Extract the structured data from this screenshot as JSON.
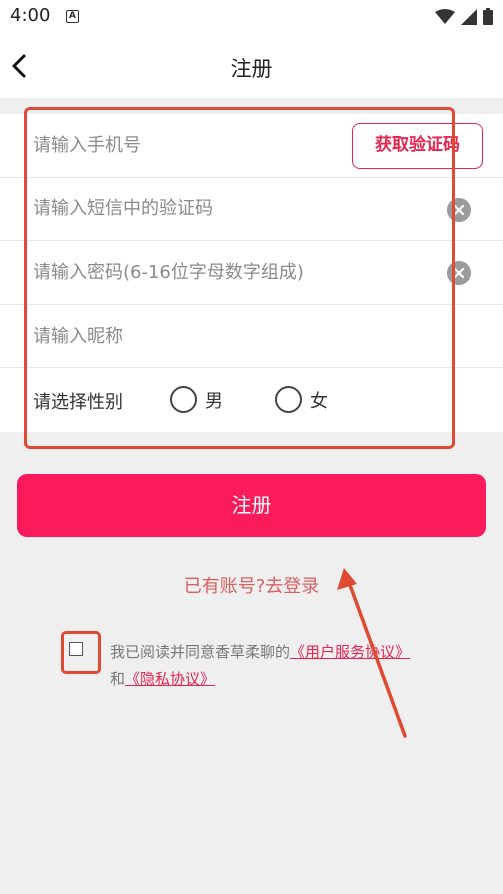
{
  "status": {
    "time": "4:00",
    "app_icon": "A"
  },
  "header": {
    "title": "注册"
  },
  "form": {
    "phone_placeholder": "请输入手机号",
    "get_code_label": "获取验证码",
    "code_placeholder": "请输入短信中的验证码",
    "password_placeholder": "请输入密码(6-16位字母数字组成)",
    "nickname_placeholder": "请输入昵称",
    "gender_label": "请选择性别",
    "gender_male": "男",
    "gender_female": "女"
  },
  "register_label": "注册",
  "login_link": "已有账号?去登录",
  "agreement": {
    "prefix": "我已阅读并同意香草柔聊的",
    "user_agreement": "《用户服务协议》",
    "and": "和",
    "privacy_policy": "《隐私协议》"
  },
  "colors": {
    "accent": "#fb1a5a",
    "link": "#e8254f",
    "annotation": "#e04a33"
  }
}
